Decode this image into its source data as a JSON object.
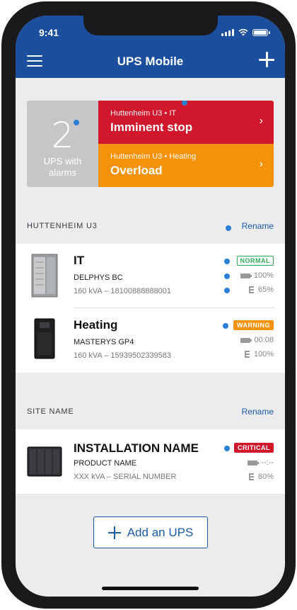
{
  "status_bar": {
    "time": "9:41"
  },
  "header": {
    "title": "UPS Mobile"
  },
  "alarm_summary": {
    "count": "2",
    "count_label_line1": "UPS with",
    "count_label_line2": "alarms",
    "alarms": [
      {
        "path": "Huttenheim U3 • IT",
        "message": "Imminent stop",
        "color": "#d0172c"
      },
      {
        "path": "Huttenheim U3 • Heating",
        "message": "Overload",
        "color": "#f5920a"
      }
    ]
  },
  "sites": [
    {
      "name": "HUTTENHEIM U3",
      "rename_label": "Rename",
      "ups": [
        {
          "name": "IT",
          "model": "DELPHYS BC",
          "serial": "160 kVA – 18100888888001",
          "status": "NORMAL",
          "battery": "100%",
          "load": "65%"
        },
        {
          "name": "Heating",
          "model": "MASTERYS GP4",
          "serial": "160 kVA – 15939502339583",
          "status": "WARNING",
          "battery": "00:08",
          "load": "100%"
        }
      ]
    },
    {
      "name": "SITE NAME",
      "rename_label": "Rename",
      "ups": [
        {
          "name": "INSTALLATION NAME",
          "model": "PRODUCT NAME",
          "serial": "XXX kVA – SERIAL NUMBER",
          "status": "CRITICAL",
          "battery": "--:--",
          "load": "80%"
        }
      ]
    }
  ],
  "add_button_label": "Add an UPS",
  "colors": {
    "header_blue": "#1b4f9e",
    "accent_blue": "#2b7fd6",
    "normal_green": "#2eaa5b",
    "warning_orange": "#f5920a",
    "critical_red": "#d0172c"
  }
}
